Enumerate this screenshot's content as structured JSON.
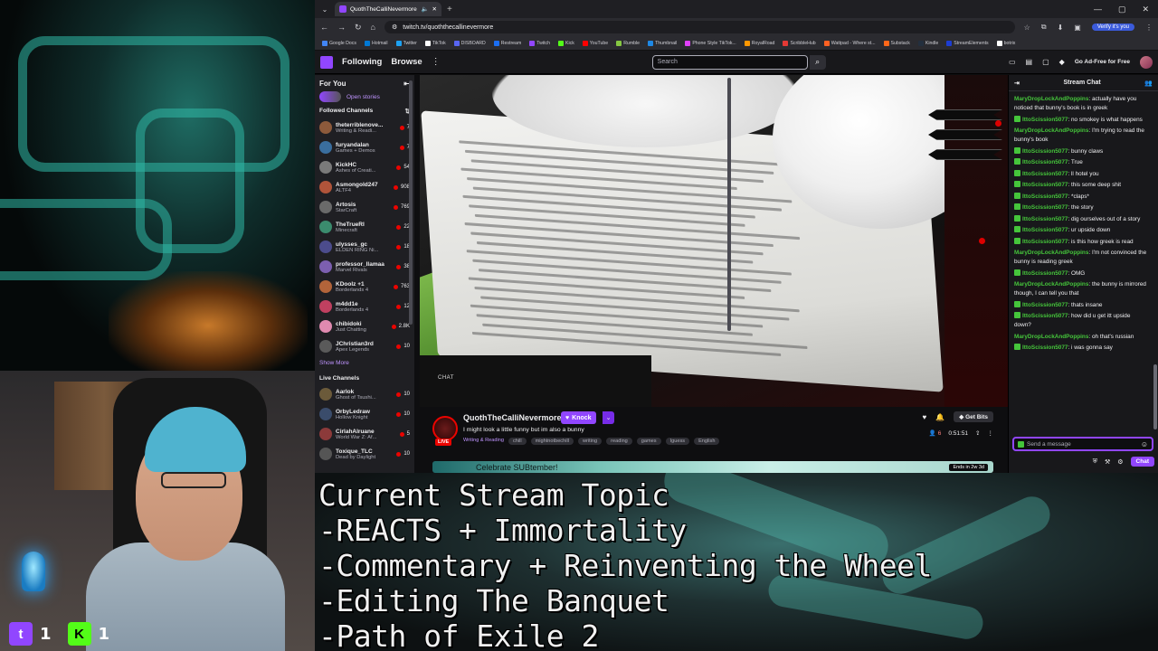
{
  "browser": {
    "tab_title": "QuothTheCalliNevermore",
    "url": "twitch.tv/quoththecallinevermore",
    "verify_label": "Verify it's you",
    "bookmarks": [
      {
        "label": "Google Docs",
        "color": "#4285f4"
      },
      {
        "label": "Hotmail",
        "color": "#0078d4"
      },
      {
        "label": "Twitter",
        "color": "#1da1f2"
      },
      {
        "label": "TikTok",
        "color": "#ffffff"
      },
      {
        "label": "DISBOARD",
        "color": "#5865f2"
      },
      {
        "label": "Restream",
        "color": "#1b6ef3"
      },
      {
        "label": "Twitch",
        "color": "#9146ff"
      },
      {
        "label": "Kick",
        "color": "#53fc18"
      },
      {
        "label": "YouTube",
        "color": "#ff0000"
      },
      {
        "label": "Rumble",
        "color": "#85c742"
      },
      {
        "label": "Thumbnail",
        "color": "#1e88e5"
      },
      {
        "label": "Phone Style TikTok...",
        "color": "#e040fb"
      },
      {
        "label": "RoyalRoad",
        "color": "#ff9800"
      },
      {
        "label": "ScribbleHub",
        "color": "#e53935"
      },
      {
        "label": "Wattpad - Where st...",
        "color": "#ff6122"
      },
      {
        "label": "Substack",
        "color": "#ff6719"
      },
      {
        "label": "Kindle",
        "color": "#232f3e"
      },
      {
        "label": "StreamElements",
        "color": "#1d3dd2"
      },
      {
        "label": "botrix",
        "color": "#ffffff"
      }
    ]
  },
  "twitch_nav": {
    "following": "Following",
    "browse": "Browse",
    "search_placeholder": "Search",
    "ad_free": "Go Ad-Free for Free"
  },
  "sidebar": {
    "for_you": "For You",
    "open_stories": "Open stories",
    "followed_title": "Followed Channels",
    "followed": [
      {
        "name": "theterriblenove...",
        "game": "Writing & Readi...",
        "viewers": "7",
        "color": "#8d5a3b"
      },
      {
        "name": "furyandalan",
        "game": "Games + Demos",
        "viewers": "7",
        "color": "#3a6e9e"
      },
      {
        "name": "KickHC",
        "game": "Ashes of Creati...",
        "viewers": "54",
        "color": "#7a7a7a"
      },
      {
        "name": "Asmongold247",
        "game": "ALTF4",
        "viewers": "908",
        "color": "#b0543a"
      },
      {
        "name": "Artosis",
        "game": "StarCraft",
        "viewers": "769",
        "color": "#6a6a6a"
      },
      {
        "name": "TheTrueRI",
        "game": "Minecraft",
        "viewers": "22",
        "color": "#3b8c6e"
      },
      {
        "name": "ulysses_gc",
        "game": "ELDEN RING Ni...",
        "viewers": "18",
        "color": "#4c4c8c"
      },
      {
        "name": "professor_llamaa",
        "game": "Marvel Rivals",
        "viewers": "38",
        "color": "#7c5fb0"
      },
      {
        "name": "KDoolz +1",
        "game": "Borderlands 4",
        "viewers": "763",
        "color": "#b2643a"
      },
      {
        "name": "m4dd1e",
        "game": "Borderlands 4",
        "viewers": "12",
        "color": "#c04060"
      },
      {
        "name": "chibidoki",
        "game": "Just Chatting",
        "viewers": "2.8K",
        "color": "#e08ab0"
      },
      {
        "name": "JChristian3rd",
        "game": "Apex Legends",
        "viewers": "10",
        "color": "#5a5a5a"
      }
    ],
    "show_more": "Show More",
    "live_title": "Live Channels",
    "live": [
      {
        "name": "Aarlok",
        "game": "Ghost of Tsushi...",
        "viewers": "10",
        "color": "#6b5a3a"
      },
      {
        "name": "OrbyLedraw",
        "game": "Hollow Knight",
        "viewers": "10",
        "color": "#3a4c6b"
      },
      {
        "name": "CirlahAlruane",
        "game": "World War Z: Af...",
        "viewers": "5",
        "color": "#8c3a3a"
      },
      {
        "name": "Toxique_TLC",
        "game": "Dead by Daylight",
        "viewers": "10",
        "color": "#555555"
      }
    ]
  },
  "video": {
    "chat_label": "CHAT"
  },
  "stream_info": {
    "streamer": "QuothTheCalliNevermore",
    "knock": "Knock",
    "live": "LIVE",
    "title": "I might look a little funny but im also a bunny",
    "category": "Writing & Reading",
    "tags": [
      "chill",
      "mightnotbechill",
      "writing",
      "reading",
      "games",
      "Iguess",
      "English"
    ],
    "get_bits": "Get Bits",
    "viewers": "6",
    "uptime": "0:51:51",
    "banner": "Celebrate SUBtember!",
    "banner_ends": "Ends in 2w 3d"
  },
  "chat": {
    "title": "Stream Chat",
    "messages": [
      {
        "user": "MaryDropLockAndPoppins",
        "color": "#45c53b",
        "badge": false,
        "text": "actually have you noticed that bunny's book is in greek"
      },
      {
        "user": "IttoScission5077",
        "color": "#45c53b",
        "badge": true,
        "text": "no smokey is what happens"
      },
      {
        "user": "MaryDropLockAndPoppins",
        "color": "#45c53b",
        "badge": false,
        "text": "I'm trying to read the bunny's book"
      },
      {
        "user": "IttoScission5077",
        "color": "#45c53b",
        "badge": true,
        "text": "bunny claws"
      },
      {
        "user": "IttoScission5077",
        "color": "#45c53b",
        "badge": true,
        "text": "True"
      },
      {
        "user": "IttoScission5077",
        "color": "#45c53b",
        "badge": true,
        "text": "ll hotel you"
      },
      {
        "user": "IttoScission5077",
        "color": "#45c53b",
        "badge": true,
        "text": "this some deep shit"
      },
      {
        "user": "IttoScission5077",
        "color": "#45c53b",
        "badge": true,
        "text": "*claps*"
      },
      {
        "user": "IttoScission5077",
        "color": "#45c53b",
        "badge": true,
        "text": "the story"
      },
      {
        "user": "IttoScission5077",
        "color": "#45c53b",
        "badge": true,
        "text": "dig ourselves out of a story"
      },
      {
        "user": "IttoScission5077",
        "color": "#45c53b",
        "badge": true,
        "text": "ur upside down"
      },
      {
        "user": "IttoScission5077",
        "color": "#45c53b",
        "badge": true,
        "text": "is this how greek is read"
      },
      {
        "user": "MaryDropLockAndPoppins",
        "color": "#45c53b",
        "badge": false,
        "text": "I'm not convinced the bunny is reading greek"
      },
      {
        "user": "IttoScission5077",
        "color": "#45c53b",
        "badge": true,
        "text": "OMG"
      },
      {
        "user": "MaryDropLockAndPoppins",
        "color": "#45c53b",
        "badge": false,
        "text": "the bunny is mirrored though, I can tell you that"
      },
      {
        "user": "IttoScission5077",
        "color": "#45c53b",
        "badge": true,
        "text": "thats insane"
      },
      {
        "user": "IttoScission5077",
        "color": "#45c53b",
        "badge": true,
        "text": "how did u get itt upside down?"
      },
      {
        "user": "MaryDropLockAndPoppins",
        "color": "#45c53b",
        "badge": false,
        "text": "oh that's russian"
      },
      {
        "user": "IttoScission5077",
        "color": "#45c53b",
        "badge": true,
        "text": "i was gonna say"
      }
    ],
    "input_placeholder": "Send a message",
    "chat_button": "Chat"
  },
  "overlay": {
    "topics": [
      "Current Stream Topic",
      "-REACTS + Immortality",
      "-Commentary + Reinventing the Wheel",
      "-Editing The Banquet",
      "-Path of Exile 2"
    ],
    "twitch_count": "1",
    "kick_count": "1"
  }
}
